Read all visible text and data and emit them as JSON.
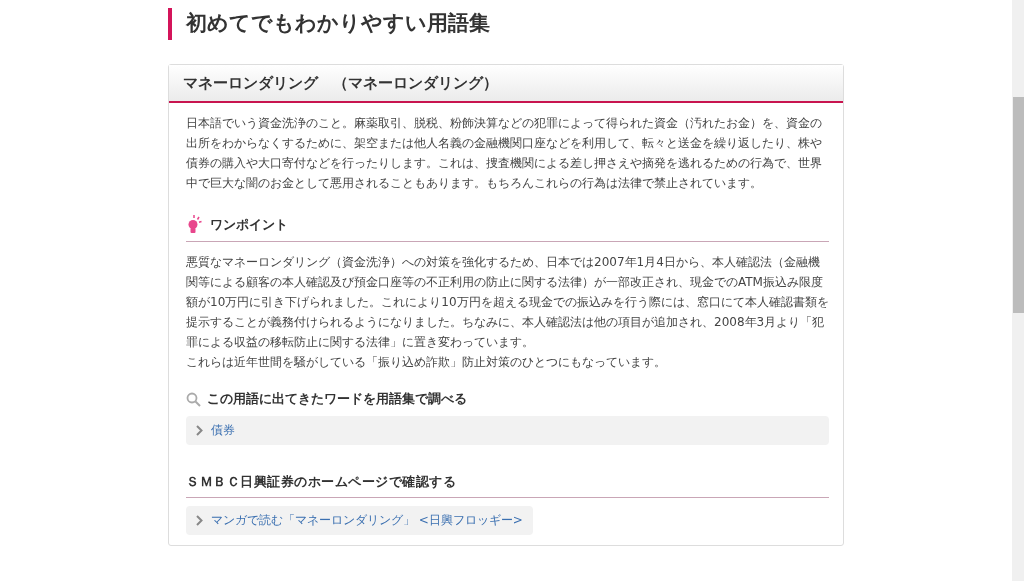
{
  "page_title": "初めてでもわかりやすい用語集",
  "term": {
    "title": "マネーロンダリング　（マネーロンダリング）",
    "description": "日本語でいう資金洗浄のこと。麻薬取引、脱税、粉飾決算などの犯罪によって得られた資金（汚れたお金）を、資金の出所をわからなくするために、架空または他人名義の金融機関口座などを利用して、転々と送金を繰り返したり、株や債券の購入や大口寄付などを行ったりします。これは、捜査機関による差し押さえや摘発を逃れるための行為で、世界中で巨大な闇のお金として悪用されることもあります。もちろんこれらの行為は法律で禁止されています。",
    "one_point": {
      "heading": "ワンポイント",
      "paragraphs": [
        "悪質なマネーロンダリング（資金洗浄）への対策を強化するため、日本では2007年1月4日から、本人確認法（金融機関等による顧客の本人確認及び預金口座等の不正利用の防止に関する法律）が一部改正され、現金でのATM振込み限度額が10万円に引き下げられました。これにより10万円を超える現金での振込みを行う際には、窓口にて本人確認書類を提示することが義務付けられるようになりました。ちなみに、本人確認法は他の項目が追加され、2008年3月より「犯罪による収益の移転防止に関する法律」に置き変わっています。",
        "これらは近年世間を騒がしている「振り込め詐欺」防止対策のひとつにもなっています。"
      ]
    },
    "related": {
      "heading": "この用語に出てきたワードを用語集で調べる",
      "links": [
        "債券"
      ]
    },
    "smbc": {
      "heading": "ＳＭＢＣ日興証券のホームページで確認する",
      "links": [
        "マンガで読む「マネーロンダリング」 <日興フロッギー>"
      ]
    }
  }
}
